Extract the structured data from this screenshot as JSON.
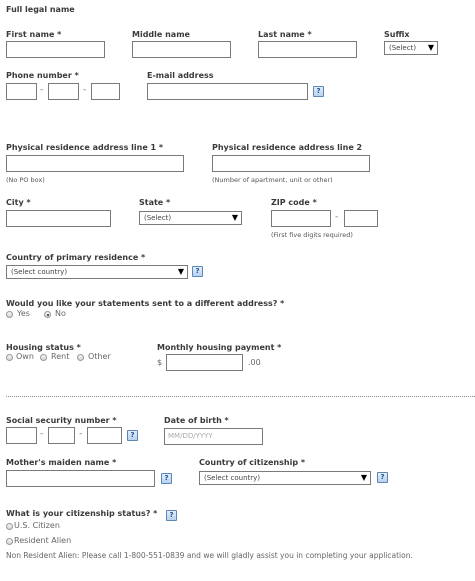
{
  "section_title": "Full legal name",
  "name": {
    "first_label": "First name *",
    "middle_label": "Middle name",
    "last_label": "Last name *",
    "suffix_label": "Suffix",
    "suffix_value": "(Select)"
  },
  "contact": {
    "phone_label": "Phone number *",
    "phone_sep": "-",
    "email_label": "E-mail address",
    "help_glyph": "?"
  },
  "address": {
    "line1_label": "Physical residence address line 1 *",
    "line1_hint": "(No PO box)",
    "line2_label": "Physical residence address line 2",
    "line2_hint": "(Number of apartment, unit or other)",
    "city_label": "City *",
    "state_label": "State *",
    "state_value": "(Select)",
    "zip_label": "ZIP code *",
    "zip_sep": "-",
    "zip_hint": "(First five digits required)",
    "country_label": "Country of primary residence *",
    "country_value": "(Select country)"
  },
  "statements": {
    "question": "Would you like your statements sent to a different address? *",
    "yes": "Yes",
    "no": "No",
    "selected": "No"
  },
  "housing": {
    "status_label": "Housing status *",
    "own": "Own",
    "rent": "Rent",
    "other": "Other",
    "payment_label": "Monthly housing payment *",
    "currency": "$",
    "cents": ".00"
  },
  "identity": {
    "ssn_label": "Social security number *",
    "ssn_sep": "-",
    "dob_label": "Date of birth *",
    "dob_placeholder": "MM/DD/YYYY",
    "maiden_label": "Mother's maiden name *",
    "citizenship_label": "Country of citizenship *",
    "citizenship_value": "(Select country)"
  },
  "citizenship_status": {
    "question": "What is your citizenship status? *",
    "us_citizen": "U.S. Citizen",
    "resident_alien": "Resident Alien",
    "note": "Non Resident Alien: Please call 1-800-551-0839 and we will gladly assist you in completing your application."
  },
  "icons": {
    "help": "help-icon",
    "dropdown": "chevron-down-icon"
  },
  "colors": {
    "help_border": "#5b86b8",
    "help_text": "#1f4f8f"
  }
}
